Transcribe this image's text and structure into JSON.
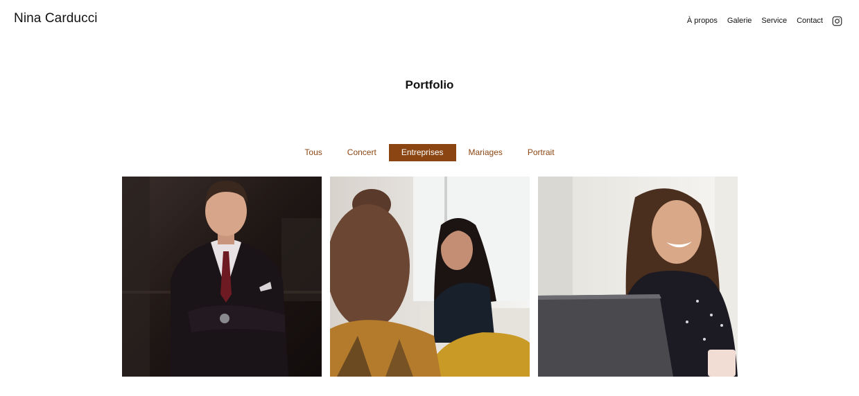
{
  "header": {
    "brand": "Nina Carducci",
    "nav": [
      {
        "label": "À propos"
      },
      {
        "label": "Galerie"
      },
      {
        "label": "Service"
      },
      {
        "label": "Contact"
      }
    ],
    "social_icon": "instagram-icon"
  },
  "portfolio": {
    "title": "Portfolio",
    "filters": [
      "Tous",
      "Concert",
      "Entreprises",
      "Mariages",
      "Portrait"
    ],
    "active_filter": "Entreprises"
  },
  "colors": {
    "accent": "#8b4513"
  }
}
